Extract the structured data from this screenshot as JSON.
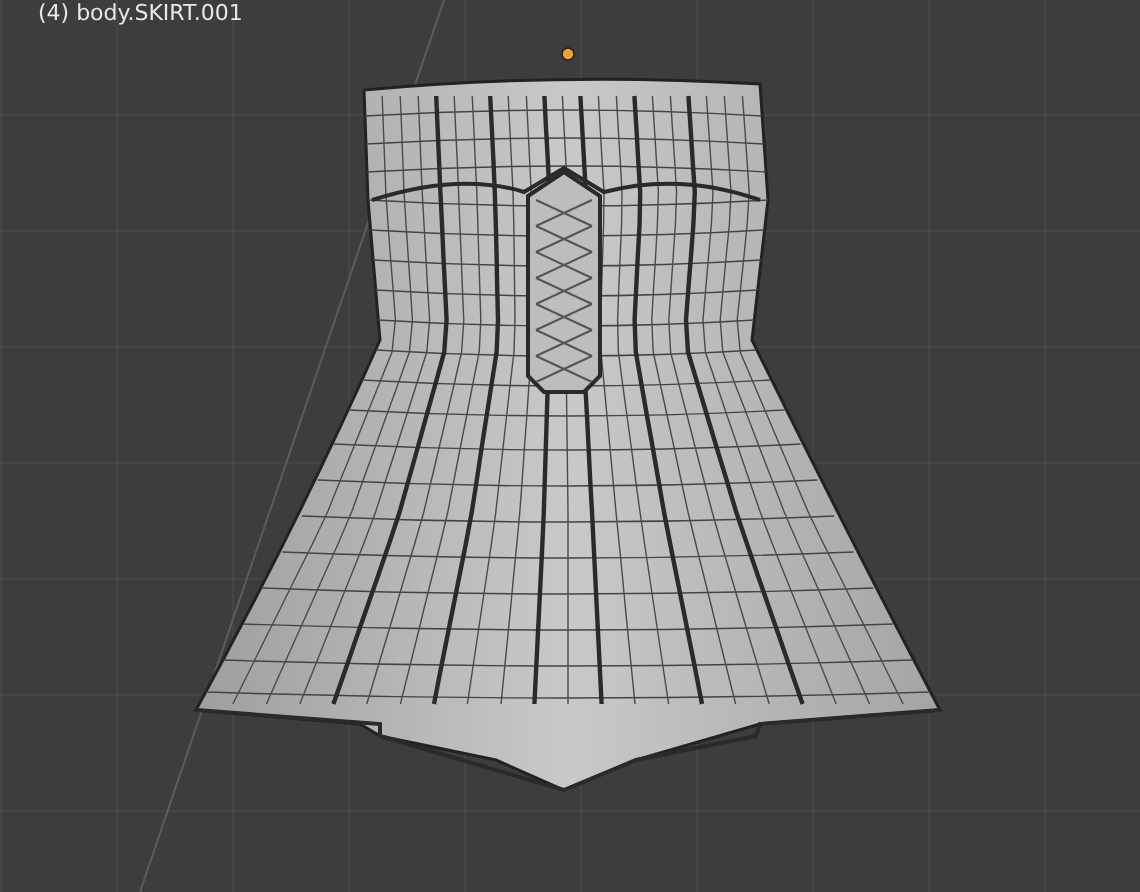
{
  "viewport": {
    "object_label": "(4) body.SKIRT.001"
  }
}
